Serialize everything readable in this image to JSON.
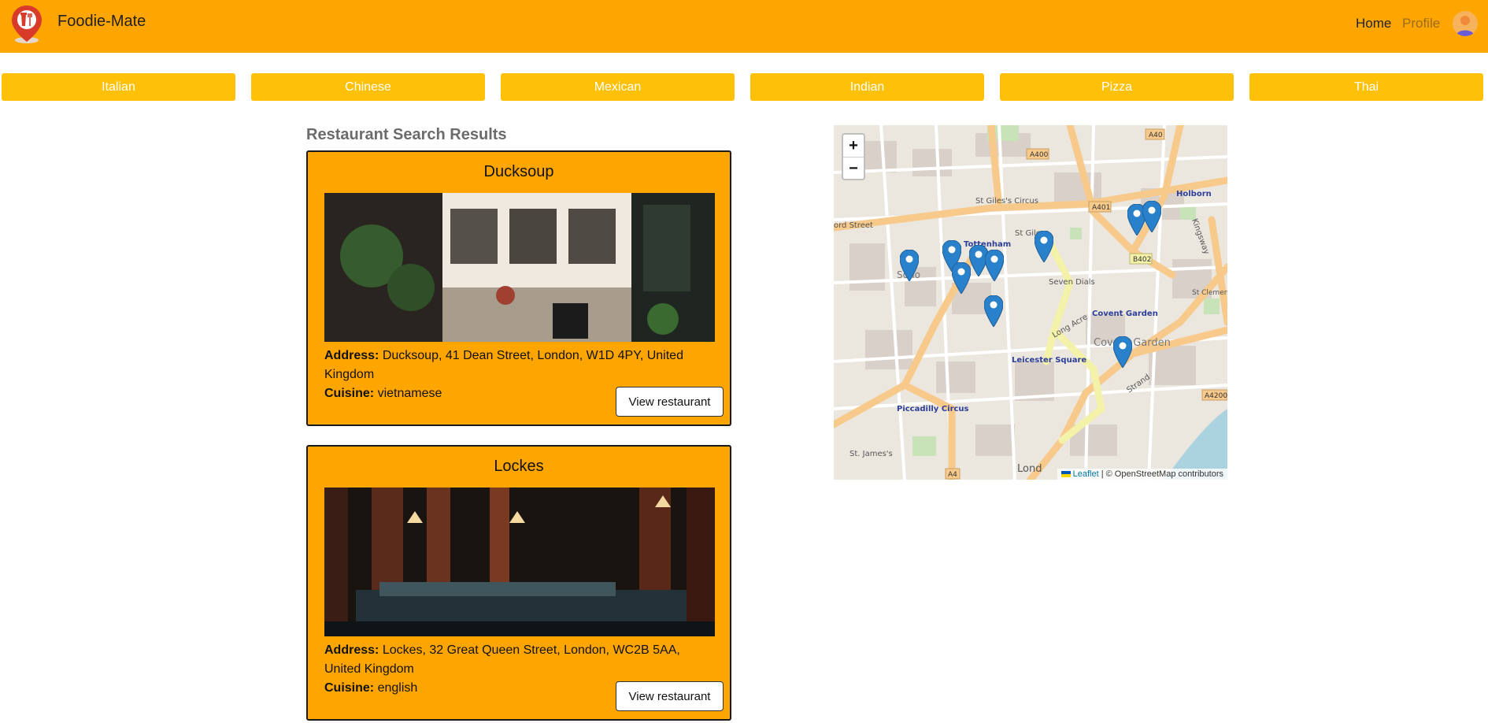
{
  "header": {
    "brand": "Foodie-Mate",
    "nav": {
      "home": "Home",
      "profile": "Profile"
    }
  },
  "categories": [
    "Italian",
    "Chinese",
    "Mexican",
    "Indian",
    "Pizza",
    "Thai"
  ],
  "results_heading": "Restaurant Search Results",
  "restaurants": [
    {
      "name": "Ducksoup",
      "address_label": "Address:",
      "address": "Ducksoup, 41 Dean Street, London, W1D 4PY, United Kingdom",
      "cuisine_label": "Cuisine:",
      "cuisine": "vietnamese",
      "button": "View restaurant"
    },
    {
      "name": "Lockes",
      "address_label": "Address:",
      "address": "Lockes, 32 Great Queen Street, London, WC2B 5AA, United Kingdom",
      "cuisine_label": "Cuisine:",
      "cuisine": "english",
      "button": "View restaurant"
    }
  ],
  "map": {
    "zoom_in": "+",
    "zoom_out": "−",
    "attribution_link": "Leaflet",
    "attribution_text": " | © OpenStreetMap contributors",
    "labels": {
      "holborn": "Holborn",
      "tottenham": "Tottenham",
      "stgiles": "St Giles",
      "stgiles_circus": "St Giles's Circus",
      "sevendials": "Seven Dials",
      "coventgarden_stn": "Covent Garden",
      "coventgarden_area": "Covent Garden",
      "leicester": "Leicester Square",
      "piccadilly": "Piccadilly Circus",
      "soho": "Soho",
      "strand": "Strand",
      "a400": "A400",
      "a401": "A401",
      "a40": "A40",
      "b402": "B402",
      "a4": "A4",
      "a4200": "A4200",
      "longacre": "Long Acre",
      "kingsway": "Kingsway",
      "oxford": "ord Street",
      "london": "Lond",
      "stjames": "St. James's",
      "stclement": "St Clement Danes"
    }
  },
  "colors": {
    "navbar": "#FFA500",
    "category_button": "#FFC107",
    "card": "#FFA500",
    "marker": "#2A81CB"
  }
}
